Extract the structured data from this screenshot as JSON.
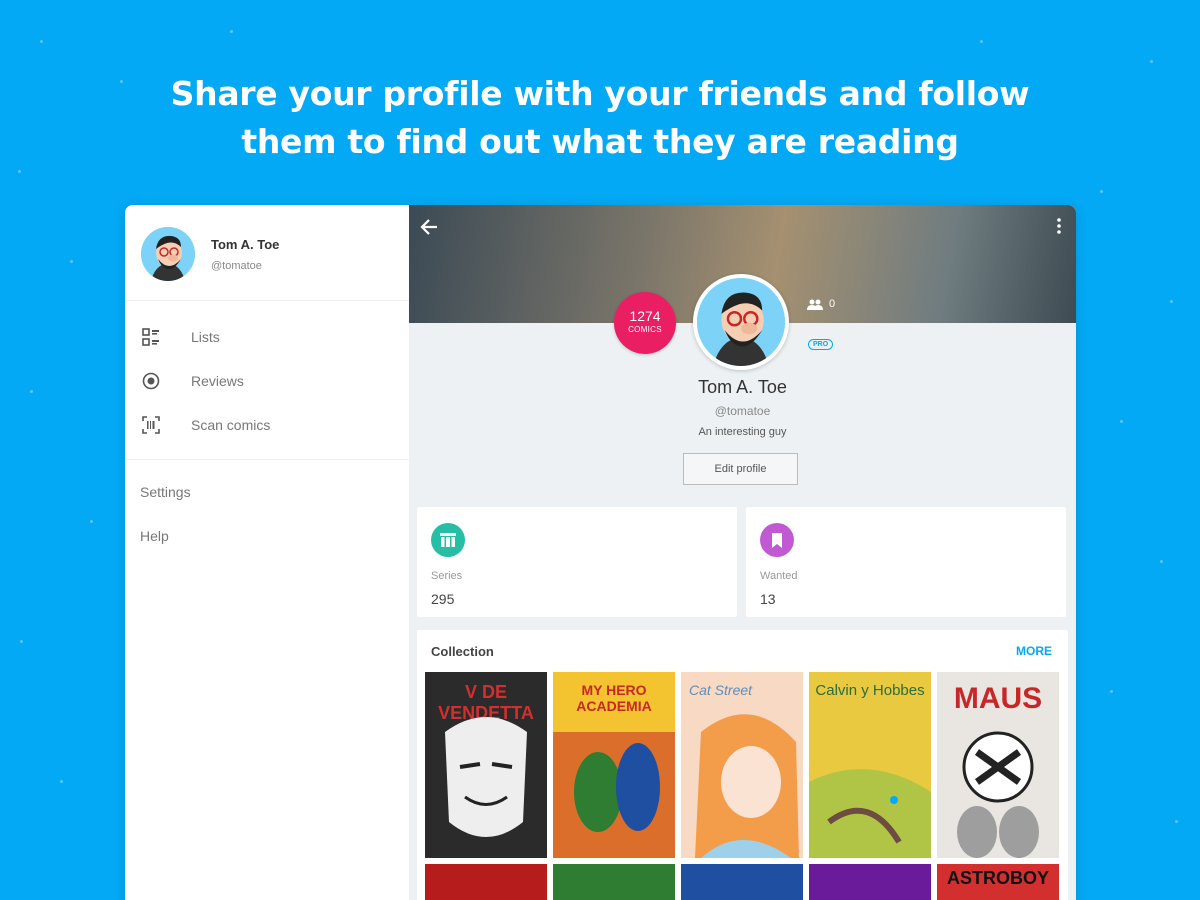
{
  "headline": {
    "line1": "Share your profile with your friends and follow",
    "line2": "them to find out what they are reading"
  },
  "drawer": {
    "user_name": "Tom A. Toe",
    "user_handle": "@tomatoe",
    "items": [
      {
        "label": "Lists",
        "icon": "lists-icon"
      },
      {
        "label": "Reviews",
        "icon": "reviews-icon"
      },
      {
        "label": "Scan comics",
        "icon": "scan-icon"
      }
    ],
    "secondary": [
      {
        "label": "Settings"
      },
      {
        "label": "Help"
      }
    ]
  },
  "profile": {
    "comics_count": "1274",
    "comics_unit": "COMICS",
    "followers": "0",
    "badge": "PRO",
    "name": "Tom A. Toe",
    "handle": "@tomatoe",
    "bio": "An interesting guy",
    "edit_label": "Edit profile"
  },
  "stats": [
    {
      "label": "Series",
      "value": "295",
      "color": "#26BFA6",
      "icon": "series-icon"
    },
    {
      "label": "Wanted",
      "value": "13",
      "color": "#C159D3",
      "icon": "bookmark-icon"
    }
  ],
  "collection": {
    "title": "Collection",
    "more_label": "MORE",
    "covers": [
      {
        "name": "cover-v-for-vendetta",
        "text": "V DE VENDETTA",
        "bg": "#2b2b2b",
        "fg": "#d32f2f"
      },
      {
        "name": "cover-my-hero-academia",
        "text": "MY HERO ACADEMIA",
        "bg": "#f4c430",
        "fg": "#c62828"
      },
      {
        "name": "cover-cat-street",
        "text": "Cat Street",
        "bg": "#f7d9c4",
        "fg": "#5a8fbf"
      },
      {
        "name": "cover-calvin-and-hobbes",
        "text": "Calvin y Hobbes",
        "bg": "#e8c940",
        "fg": "#2b6d3a"
      },
      {
        "name": "cover-maus",
        "text": "MAUS",
        "bg": "#e9e6e1",
        "fg": "#c62828"
      },
      {
        "name": "cover-row2-1",
        "text": "",
        "bg": "#b71c1c",
        "fg": "#ffffff"
      },
      {
        "name": "cover-row2-2",
        "text": "",
        "bg": "#2e7d32",
        "fg": "#ffffff"
      },
      {
        "name": "cover-row2-3",
        "text": "",
        "bg": "#1e4fa0",
        "fg": "#ffffff"
      },
      {
        "name": "cover-row2-4",
        "text": "",
        "bg": "#6a1b9a",
        "fg": "#ffffff"
      },
      {
        "name": "cover-astroboy",
        "text": "ASTROBOY",
        "bg": "#d32f2f",
        "fg": "#ffffff"
      }
    ]
  }
}
